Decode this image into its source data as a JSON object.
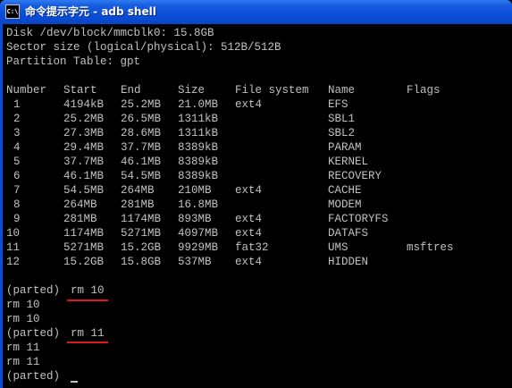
{
  "window": {
    "title": "命令提示字元 - adb shell",
    "icon": "cmd-icon",
    "icon_text": "C:\\"
  },
  "colors": {
    "titlebar": "#0a4ed8",
    "console_bg": "#000000",
    "console_fg": "#c0c0c0",
    "annotation": "#e01818"
  },
  "disk_info": [
    "Disk /dev/block/mmcblk0: 15.8GB",
    "Sector size (logical/physical): 512B/512B",
    "Partition Table: gpt"
  ],
  "table": {
    "headers": {
      "number": "Number",
      "start": "Start",
      "end": "End",
      "size": "Size",
      "file_system": "File system",
      "name": "Name",
      "flags": "Flags"
    },
    "rows": [
      {
        "number": "1",
        "start": "4194kB",
        "end": "25.2MB",
        "size": "21.0MB",
        "file_system": "ext4",
        "name": "EFS",
        "flags": ""
      },
      {
        "number": "2",
        "start": "25.2MB",
        "end": "26.5MB",
        "size": "1311kB",
        "file_system": "",
        "name": "SBL1",
        "flags": ""
      },
      {
        "number": "3",
        "start": "27.3MB",
        "end": "28.6MB",
        "size": "1311kB",
        "file_system": "",
        "name": "SBL2",
        "flags": ""
      },
      {
        "number": "4",
        "start": "29.4MB",
        "end": "37.7MB",
        "size": "8389kB",
        "file_system": "",
        "name": "PARAM",
        "flags": ""
      },
      {
        "number": "5",
        "start": "37.7MB",
        "end": "46.1MB",
        "size": "8389kB",
        "file_system": "",
        "name": "KERNEL",
        "flags": ""
      },
      {
        "number": "6",
        "start": "46.1MB",
        "end": "54.5MB",
        "size": "8389kB",
        "file_system": "",
        "name": "RECOVERY",
        "flags": ""
      },
      {
        "number": "7",
        "start": "54.5MB",
        "end": "264MB",
        "size": "210MB",
        "file_system": "ext4",
        "name": "CACHE",
        "flags": ""
      },
      {
        "number": "8",
        "start": "264MB",
        "end": "281MB",
        "size": "16.8MB",
        "file_system": "",
        "name": "MODEM",
        "flags": ""
      },
      {
        "number": "9",
        "start": "281MB",
        "end": "1174MB",
        "size": "893MB",
        "file_system": "ext4",
        "name": "FACTORYFS",
        "flags": ""
      },
      {
        "number": "10",
        "start": "1174MB",
        "end": "5271MB",
        "size": "4097MB",
        "file_system": "ext4",
        "name": "DATAFS",
        "flags": ""
      },
      {
        "number": "11",
        "start": "5271MB",
        "end": "15.2GB",
        "size": "9929MB",
        "file_system": "fat32",
        "name": "UMS",
        "flags": "msftres"
      },
      {
        "number": "12",
        "start": "15.2GB",
        "end": "15.8GB",
        "size": "537MB",
        "file_system": "ext4",
        "name": "HIDDEN",
        "flags": ""
      }
    ]
  },
  "session": {
    "prompt": "(parted)",
    "command1": "rm 10",
    "echo1a": "rm 10",
    "echo1b": "rm 10",
    "command2": "rm 11",
    "echo2a": "rm 11",
    "echo2b": "rm 11"
  }
}
